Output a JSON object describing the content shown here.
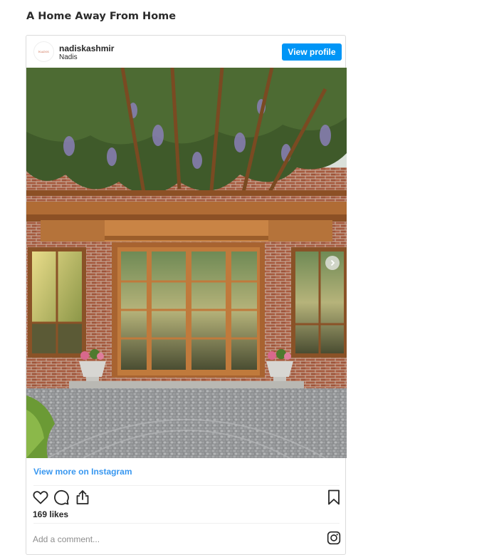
{
  "page": {
    "title": "A Home Away From Home"
  },
  "post": {
    "avatar_text": "NADIS",
    "username": "nadiskashmir",
    "location": "Nadis",
    "view_profile_label": "View profile",
    "view_more_label": "View more on Instagram",
    "likes": "169 likes",
    "comment_placeholder": "Add a comment..."
  },
  "icons": {
    "like": "heart-icon",
    "comment": "comment-icon",
    "share": "share-icon",
    "save": "bookmark-icon",
    "instagram": "instagram-icon",
    "next": "chevron-right-icon"
  },
  "colors": {
    "accent": "#0095f6",
    "link": "#3897f0",
    "text": "#262626",
    "muted": "#8e8e8e"
  }
}
